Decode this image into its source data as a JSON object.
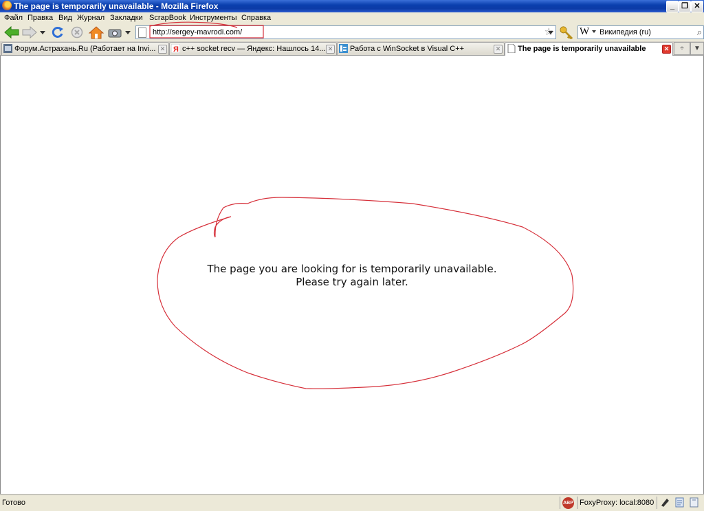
{
  "window": {
    "title": "The page is temporarily unavailable - Mozilla Firefox",
    "minimize": "_",
    "restore": "❐",
    "close": "✕"
  },
  "menu": [
    "Файл",
    "Правка",
    "Вид",
    "Журнал",
    "Закладки",
    "ScrapBook",
    "Инструменты",
    "Справка"
  ],
  "navbar": {
    "url": "http://sergey-mavrodi.com/",
    "search_engine_logo": "W",
    "search_engine": "Википедия (ru)"
  },
  "tabs": [
    {
      "label": "Форум.Астрахань.Ru (Работает на Invi...",
      "selected": false
    },
    {
      "label": "c++ socket recv — Яндекс: Нашлось 14...",
      "selected": false
    },
    {
      "label": "Работа с WinSocket в Visual C++",
      "selected": false
    },
    {
      "label": "The page is temporarily unavailable",
      "selected": true
    }
  ],
  "content": {
    "line1": "The page you are looking for is temporarily unavailable.",
    "line2": "Please try again later."
  },
  "statusbar": {
    "status": "Готово",
    "adblock": "ABP",
    "proxy": "FoxyProxy: local:8080"
  },
  "colors": {
    "annotation": "#d6303a",
    "titlebar": "#0a3fae"
  }
}
